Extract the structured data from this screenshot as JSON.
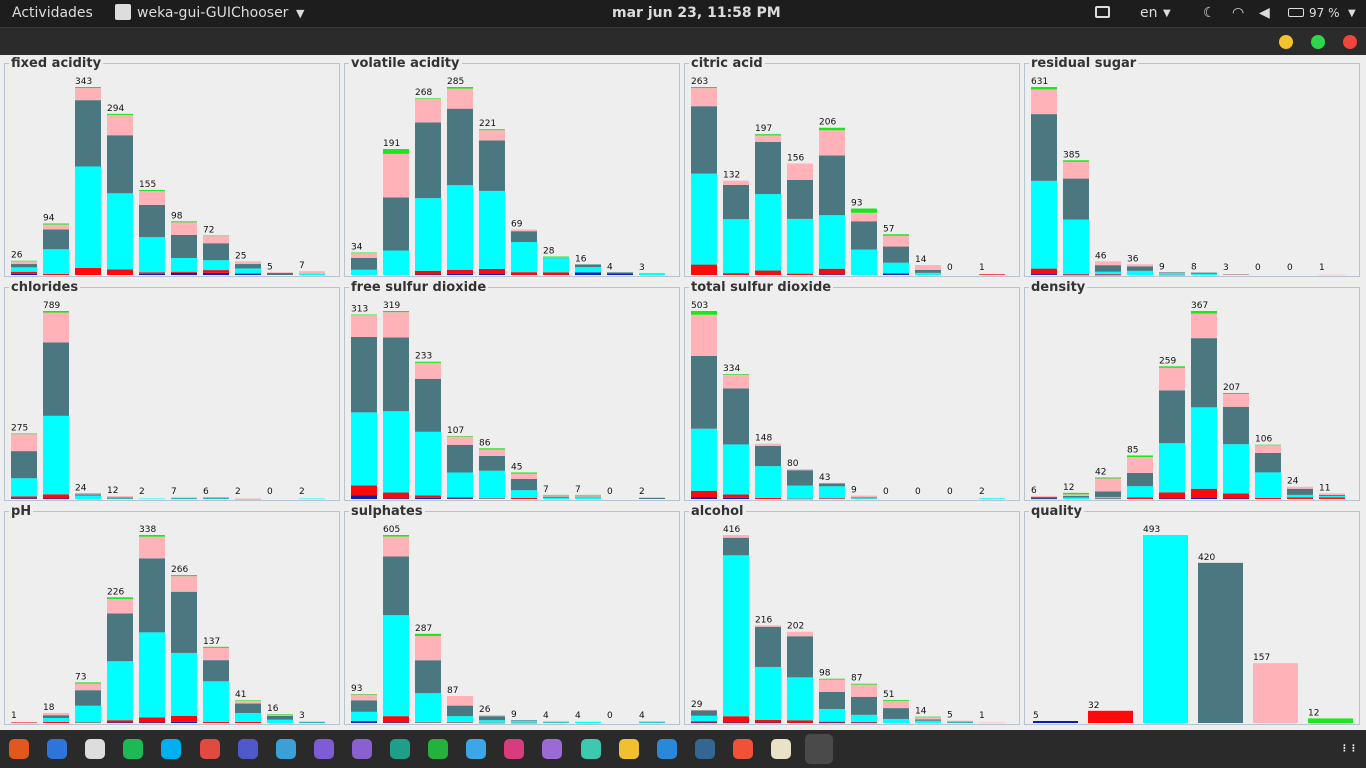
{
  "topbar": {
    "activities": "Actividades",
    "app_name": "weka-gui-GUIChooser",
    "clock": "mar jun 23, 11:58 PM",
    "language": "en",
    "battery": "97 %"
  },
  "colors": {
    "c1": "#0b1ea8",
    "c2": "#ff0a0a",
    "c3": "#00ffff",
    "c4": "#4b7780",
    "c5": "#ffb2b8",
    "c6": "#1ee61e"
  },
  "chart_data": [
    {
      "name": "fixed acidity",
      "type": "bar",
      "stacked": true,
      "labels": [
        "26",
        "94",
        "343",
        "294",
        "155",
        "98",
        "72",
        "25",
        "5",
        "7"
      ],
      "values": [
        26,
        94,
        343,
        294,
        155,
        98,
        72,
        25,
        5,
        7
      ],
      "segments": [
        [
          2,
          4,
          8,
          6,
          5,
          1
        ],
        [
          0,
          2,
          45,
          36,
          9,
          2
        ],
        [
          0,
          13,
          185,
          121,
          22,
          2
        ],
        [
          0,
          10,
          139,
          106,
          37,
          2
        ],
        [
          2,
          3,
          64,
          59,
          25,
          2
        ],
        [
          4,
          2,
          25,
          42,
          23,
          2
        ],
        [
          4,
          5,
          18,
          31,
          13,
          1
        ],
        [
          2,
          1,
          9,
          8,
          5,
          0
        ],
        [
          0,
          0,
          0,
          4,
          1,
          0
        ],
        [
          0,
          0,
          3,
          0,
          4,
          0
        ]
      ]
    },
    {
      "name": "volatile acidity",
      "type": "bar",
      "stacked": true,
      "labels": [
        "34",
        "191",
        "268",
        "285",
        "221",
        "69",
        "28",
        "16",
        "4",
        "3"
      ],
      "values": [
        34,
        191,
        268,
        285,
        221,
        69,
        28,
        16,
        4,
        3
      ],
      "segments": [
        [
          0,
          0,
          8,
          18,
          7,
          1
        ],
        [
          0,
          0,
          40,
          87,
          71,
          8
        ],
        [
          1,
          7,
          138,
          144,
          45,
          1
        ],
        [
          2,
          8,
          160,
          145,
          38,
          3
        ],
        [
          2,
          10,
          153,
          99,
          20,
          2
        ],
        [
          0,
          5,
          53,
          19,
          3,
          0
        ],
        [
          0,
          5,
          26,
          1,
          1,
          1
        ],
        [
          4,
          0,
          8,
          4,
          0,
          0
        ],
        [
          2,
          1,
          0,
          1,
          0,
          0
        ],
        [
          0,
          0,
          3,
          0,
          0,
          0
        ]
      ]
    },
    {
      "name": "citric acid",
      "type": "bar",
      "stacked": true,
      "labels": [
        "263",
        "132",
        "197",
        "156",
        "206",
        "93",
        "57",
        "14",
        "0",
        "1"
      ],
      "values": [
        263,
        132,
        197,
        156,
        206,
        93,
        57,
        14,
        0,
        1
      ],
      "segments": [
        [
          0,
          19,
          166,
          123,
          33,
          2
        ],
        [
          0,
          3,
          88,
          56,
          7,
          0
        ],
        [
          0,
          7,
          120,
          82,
          10,
          2
        ],
        [
          0,
          2,
          80,
          57,
          24,
          0
        ],
        [
          1,
          9,
          85,
          95,
          40,
          4
        ],
        [
          0,
          0,
          36,
          40,
          12,
          6
        ],
        [
          2,
          0,
          14,
          21,
          14,
          2
        ],
        [
          0,
          0,
          3,
          4,
          7,
          0
        ],
        [
          0,
          0,
          0,
          0,
          0,
          0
        ],
        [
          0,
          1,
          0,
          0,
          0,
          0
        ]
      ]
    },
    {
      "name": "residual sugar",
      "type": "bar",
      "stacked": true,
      "labels": [
        "631",
        "385",
        "46",
        "36",
        "9",
        "8",
        "3",
        "0",
        "0",
        "1"
      ],
      "values": [
        631,
        385,
        46,
        36,
        9,
        8,
        3,
        0,
        0,
        1
      ],
      "segments": [
        [
          3,
          18,
          288,
          219,
          81,
          8
        ],
        [
          1,
          2,
          176,
          132,
          54,
          5
        ],
        [
          1,
          2,
          8,
          22,
          13,
          0
        ],
        [
          0,
          0,
          14,
          15,
          7,
          0
        ],
        [
          0,
          1,
          6,
          2,
          0,
          0
        ],
        [
          0,
          0,
          4,
          4,
          0,
          0
        ],
        [
          0,
          0,
          0,
          2,
          1,
          0
        ],
        [
          0,
          0,
          0,
          0,
          0,
          0
        ],
        [
          0,
          0,
          0,
          0,
          0,
          0
        ],
        [
          0,
          0,
          0,
          0,
          1,
          0
        ]
      ]
    },
    {
      "name": "chlorides",
      "type": "bar",
      "stacked": true,
      "labels": [
        "275",
        "789",
        "24",
        "12",
        "2",
        "7",
        "6",
        "2",
        "0",
        "2"
      ],
      "values": [
        275,
        789,
        24,
        12,
        2,
        7,
        6,
        2,
        0,
        2
      ],
      "segments": [
        [
          3,
          8,
          76,
          114,
          71,
          3
        ],
        [
          2,
          16,
          300,
          281,
          114,
          6
        ],
        [
          0,
          0,
          14,
          6,
          2,
          2
        ],
        [
          0,
          0,
          2,
          5,
          5,
          0
        ],
        [
          0,
          0,
          2,
          0,
          0,
          0
        ],
        [
          0,
          0,
          2,
          4,
          1,
          0
        ],
        [
          0,
          0,
          2,
          4,
          0,
          0
        ],
        [
          0,
          0,
          0,
          1,
          1,
          0
        ],
        [
          0,
          0,
          0,
          0,
          0,
          0
        ],
        [
          0,
          0,
          2,
          0,
          0,
          0
        ]
      ]
    },
    {
      "name": "free sulfur dioxide",
      "type": "bar",
      "stacked": true,
      "labels": [
        "313",
        "319",
        "233",
        "107",
        "86",
        "45",
        "7",
        "7",
        "0",
        "2"
      ],
      "values": [
        313,
        319,
        233,
        107,
        86,
        45,
        7,
        7,
        0,
        2
      ],
      "segments": [
        [
          6,
          17,
          124,
          128,
          37,
          1
        ],
        [
          1,
          10,
          138,
          125,
          43,
          2
        ],
        [
          2,
          4,
          108,
          90,
          27,
          2
        ],
        [
          1,
          2,
          42,
          47,
          14,
          1
        ],
        [
          0,
          1,
          47,
          25,
          11,
          2
        ],
        [
          0,
          2,
          13,
          19,
          9,
          2
        ],
        [
          0,
          0,
          2,
          2,
          2,
          1
        ],
        [
          0,
          0,
          3,
          1,
          2,
          1
        ],
        [
          0,
          0,
          0,
          0,
          0,
          0
        ],
        [
          0,
          0,
          0,
          2,
          0,
          0
        ]
      ]
    },
    {
      "name": "total sulfur dioxide",
      "type": "bar",
      "stacked": true,
      "labels": [
        "503",
        "334",
        "148",
        "80",
        "43",
        "9",
        "0",
        "0",
        "0",
        "2"
      ],
      "values": [
        503,
        334,
        148,
        80,
        43,
        9,
        0,
        0,
        0,
        2
      ],
      "segments": [
        [
          5,
          17,
          166,
          195,
          110,
          10
        ],
        [
          3,
          9,
          134,
          150,
          36,
          2
        ],
        [
          0,
          3,
          85,
          54,
          6,
          0
        ],
        [
          0,
          1,
          35,
          41,
          3,
          0
        ],
        [
          0,
          2,
          32,
          8,
          1,
          0
        ],
        [
          0,
          0,
          2,
          2,
          5,
          0
        ],
        [
          0,
          0,
          0,
          0,
          0,
          0
        ],
        [
          0,
          0,
          0,
          0,
          0,
          0
        ],
        [
          0,
          0,
          0,
          0,
          0,
          0
        ],
        [
          0,
          0,
          2,
          0,
          0,
          0
        ]
      ]
    },
    {
      "name": "density",
      "type": "bar",
      "stacked": true,
      "labels": [
        "6",
        "12",
        "42",
        "85",
        "259",
        "367",
        "207",
        "106",
        "24",
        "11"
      ],
      "values": [
        6,
        12,
        42,
        85,
        259,
        367,
        207,
        106,
        24,
        11
      ],
      "segments": [
        [
          1,
          0,
          0,
          3,
          2,
          0
        ],
        [
          0,
          0,
          3,
          3,
          3,
          3
        ],
        [
          0,
          1,
          3,
          11,
          25,
          2
        ],
        [
          0,
          3,
          22,
          26,
          31,
          3
        ],
        [
          1,
          12,
          96,
          103,
          44,
          3
        ],
        [
          2,
          18,
          159,
          135,
          48,
          5
        ],
        [
          1,
          10,
          96,
          73,
          25,
          2
        ],
        [
          0,
          2,
          50,
          38,
          15,
          1
        ],
        [
          0,
          3,
          5,
          12,
          4,
          0
        ],
        [
          0,
          3,
          3,
          2,
          3,
          0
        ]
      ]
    },
    {
      "name": "pH",
      "type": "bar",
      "stacked": true,
      "labels": [
        "1",
        "18",
        "73",
        "226",
        "338",
        "266",
        "137",
        "41",
        "16",
        "3"
      ],
      "values": [
        1,
        18,
        73,
        226,
        338,
        266,
        137,
        41,
        16,
        3
      ],
      "segments": [
        [
          0,
          1,
          0,
          0,
          0,
          0
        ],
        [
          0,
          2,
          7,
          5,
          4,
          0
        ],
        [
          0,
          1,
          30,
          28,
          12,
          2
        ],
        [
          1,
          4,
          106,
          86,
          26,
          3
        ],
        [
          1,
          9,
          153,
          133,
          39,
          3
        ],
        [
          2,
          11,
          113,
          110,
          28,
          2
        ],
        [
          0,
          2,
          73,
          38,
          22,
          2
        ],
        [
          0,
          2,
          16,
          17,
          5,
          1
        ],
        [
          0,
          0,
          6,
          7,
          2,
          1
        ],
        [
          0,
          0,
          1,
          1,
          1,
          0
        ]
      ]
    },
    {
      "name": "sulphates",
      "type": "bar",
      "stacked": true,
      "labels": [
        "93",
        "605",
        "287",
        "87",
        "26",
        "9",
        "4",
        "4",
        "0",
        "4"
      ],
      "values": [
        93,
        605,
        287,
        87,
        26,
        9,
        4,
        4,
        0,
        4
      ],
      "segments": [
        [
          3,
          4,
          29,
          37,
          19,
          1
        ],
        [
          2,
          20,
          325,
          189,
          64,
          5
        ],
        [
          0,
          2,
          94,
          106,
          78,
          7
        ],
        [
          0,
          2,
          20,
          34,
          31,
          0
        ],
        [
          0,
          1,
          8,
          13,
          4,
          0
        ],
        [
          0,
          1,
          7,
          1,
          0,
          0
        ],
        [
          0,
          0,
          2,
          2,
          0,
          0
        ],
        [
          0,
          0,
          4,
          0,
          0,
          0
        ],
        [
          0,
          0,
          0,
          0,
          0,
          0
        ],
        [
          0,
          0,
          3,
          1,
          0,
          0
        ]
      ]
    },
    {
      "name": "alcohol",
      "type": "bar",
      "stacked": true,
      "labels": [
        "29",
        "416",
        "216",
        "202",
        "98",
        "87",
        "51",
        "14",
        "5",
        "1"
      ],
      "values": [
        29,
        416,
        216,
        202,
        98,
        87,
        51,
        14,
        5,
        1
      ],
      "segments": [
        [
          1,
          3,
          12,
          12,
          1,
          0
        ],
        [
          1,
          14,
          356,
          39,
          6,
          0
        ],
        [
          1,
          6,
          117,
          89,
          3,
          0
        ],
        [
          0,
          6,
          95,
          91,
          10,
          0
        ],
        [
          1,
          2,
          28,
          38,
          27,
          2
        ],
        [
          1,
          1,
          16,
          40,
          27,
          2
        ],
        [
          0,
          0,
          9,
          24,
          16,
          2
        ],
        [
          0,
          0,
          5,
          3,
          5,
          1
        ],
        [
          0,
          0,
          1,
          2,
          2,
          0
        ],
        [
          0,
          0,
          0,
          0,
          1,
          0
        ]
      ]
    },
    {
      "name": "quality",
      "type": "bar",
      "stacked": false,
      "labels": [
        "5",
        "32",
        "493",
        "420",
        "157",
        "12"
      ],
      "values": [
        5,
        32,
        493,
        420,
        157,
        12
      ],
      "colors": [
        "#0b1ea8",
        "#ff0a0a",
        "#00ffff",
        "#4b7780",
        "#ffb2b8",
        "#1ee61e"
      ]
    }
  ],
  "dock": [
    "Brave",
    "Finder",
    "Media",
    "Spotify",
    "Skype",
    "Video",
    "Teams",
    "TeX",
    "Browser",
    "PS",
    "CL",
    "PC",
    "WS",
    "IJ",
    "DG",
    "GO",
    "Box",
    "R",
    "Postgres",
    "Swift",
    "Notes",
    "Weka",
    "Apps"
  ]
}
